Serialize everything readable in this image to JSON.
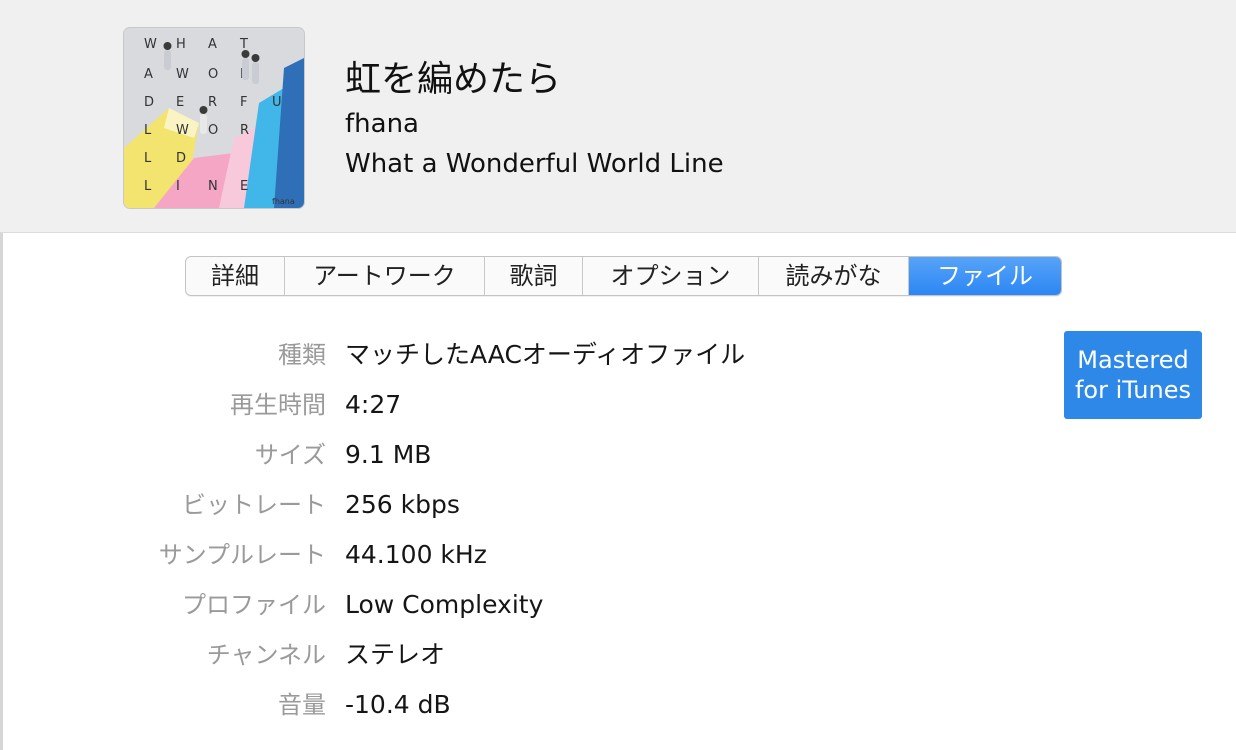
{
  "track": {
    "title": "虹を編めたら",
    "artist": "fhana",
    "album": "What a Wonderful World Line"
  },
  "artwork": {
    "letters": [
      "W",
      "H",
      "A",
      "T",
      "A",
      "W",
      "O",
      "N",
      "D",
      "E",
      "R",
      "F",
      "U",
      "L",
      "W",
      "O",
      "R",
      "L",
      "D",
      "L",
      "I",
      "N",
      "E"
    ],
    "band_mark": "fhana",
    "colors": {
      "background": "#d8dade",
      "yellow": "#f2e46e",
      "pink": "#f5a6c4",
      "cyan": "#41b6e8",
      "blue": "#2f6fb8"
    }
  },
  "tabs": [
    {
      "label": "詳細",
      "active": false
    },
    {
      "label": "アートワーク",
      "active": false
    },
    {
      "label": "歌詞",
      "active": false
    },
    {
      "label": "オプション",
      "active": false
    },
    {
      "label": "読みがな",
      "active": false
    },
    {
      "label": "ファイル",
      "active": true
    }
  ],
  "file_info": [
    {
      "label": "種類",
      "value": "マッチしたAACオーディオファイル"
    },
    {
      "label": "再生時間",
      "value": "4:27"
    },
    {
      "label": "サイズ",
      "value": "9.1 MB"
    },
    {
      "label": "ビットレート",
      "value": "256 kbps"
    },
    {
      "label": "サンプルレート",
      "value": "44.100 kHz"
    },
    {
      "label": "プロファイル",
      "value": "Low Complexity"
    },
    {
      "label": "チャンネル",
      "value": "ステレオ"
    },
    {
      "label": "音量",
      "value": "-10.4 dB"
    }
  ],
  "badge": {
    "line1": "Mastered",
    "line2": "for iTunes",
    "color": "#2e88e8"
  }
}
